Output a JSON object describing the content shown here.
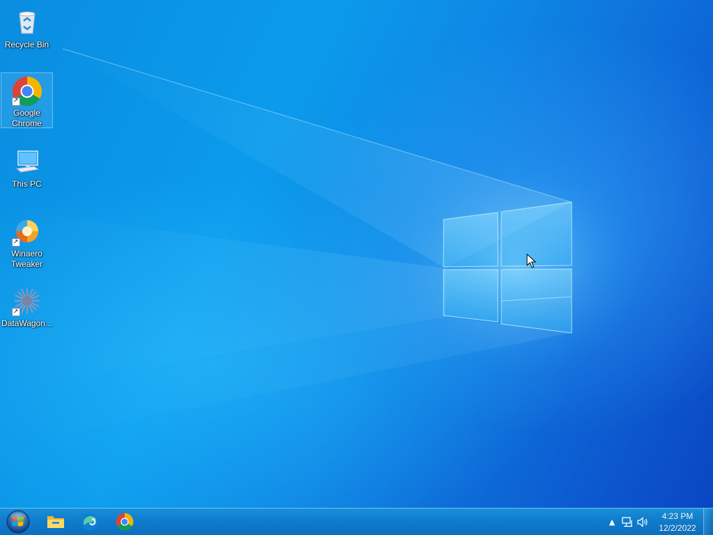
{
  "desktop": {
    "icons": [
      {
        "label": "Recycle Bin",
        "icon": "recycle-bin-icon",
        "shortcut": false
      },
      {
        "label": "Google Chrome",
        "icon": "chrome-icon",
        "shortcut": true,
        "selected": true
      },
      {
        "label": "This PC",
        "icon": "computer-icon",
        "shortcut": false
      },
      {
        "label": "Winaero Tweaker",
        "icon": "winaero-tweaker-icon",
        "shortcut": true
      },
      {
        "label": "DataWagon...",
        "icon": "datawagon-icon",
        "shortcut": true
      }
    ]
  },
  "taskbar": {
    "start": {
      "icon": "windows-orb-icon"
    },
    "pinned": [
      {
        "name": "File Explorer",
        "icon": "file-explorer-icon"
      },
      {
        "name": "Microsoft Edge",
        "icon": "edge-icon"
      },
      {
        "name": "Google Chrome",
        "icon": "chrome-icon"
      }
    ],
    "tray": {
      "icons": [
        "show-hidden-icons-icon",
        "network-icon",
        "volume-icon"
      ],
      "time": "4:23 PM",
      "date": "12/2/2022"
    }
  },
  "colors": {
    "wallpaper_accent": "#0b9bec",
    "taskbar": "#0f7ccc"
  }
}
